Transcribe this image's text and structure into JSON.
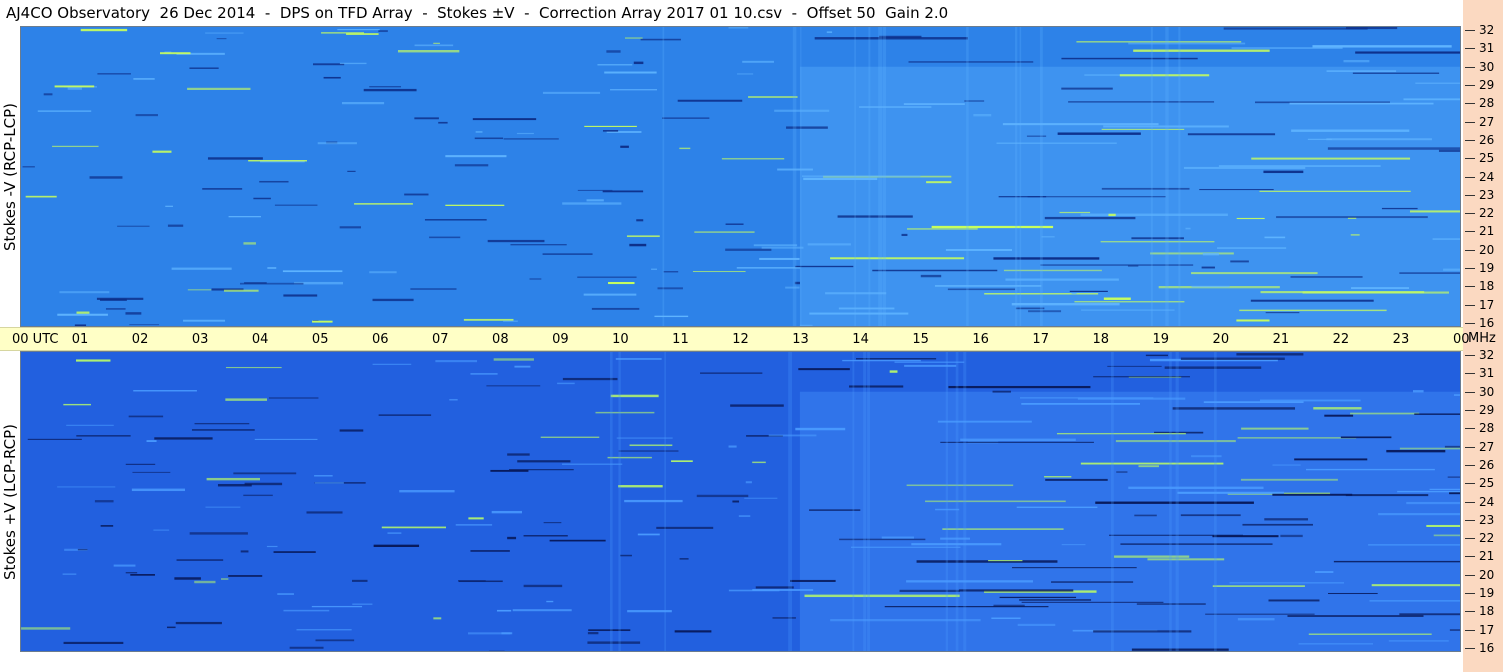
{
  "title": "AJ4CO Observatory  26 Dec 2014  -  DPS on TFD Array  -  Stokes ±V  -  Correction Array 2017 01 10.csv  -  Offset 50  Gain 2.0",
  "panels": [
    {
      "label": "Stokes -V (RCP-LCP)"
    },
    {
      "label": "Stokes +V (LCP-RCP)"
    }
  ],
  "time_axis": {
    "labels": [
      "00 UTC",
      "01",
      "02",
      "03",
      "04",
      "05",
      "06",
      "07",
      "08",
      "09",
      "10",
      "11",
      "12",
      "13",
      "14",
      "15",
      "16",
      "17",
      "18",
      "19",
      "20",
      "21",
      "22",
      "23",
      "00"
    ],
    "unit": "MHz"
  },
  "freq_axis": {
    "labels": [
      "32",
      "31",
      "30",
      "29",
      "28",
      "27",
      "26",
      "25",
      "24",
      "23",
      "22",
      "21",
      "20",
      "19",
      "18",
      "17",
      "16"
    ]
  },
  "colors": {
    "background_top": "#2d82e8",
    "background_bottom": "#2260df",
    "timebar": "#ffffc6",
    "freq_strip": "#fbd9c1"
  }
}
